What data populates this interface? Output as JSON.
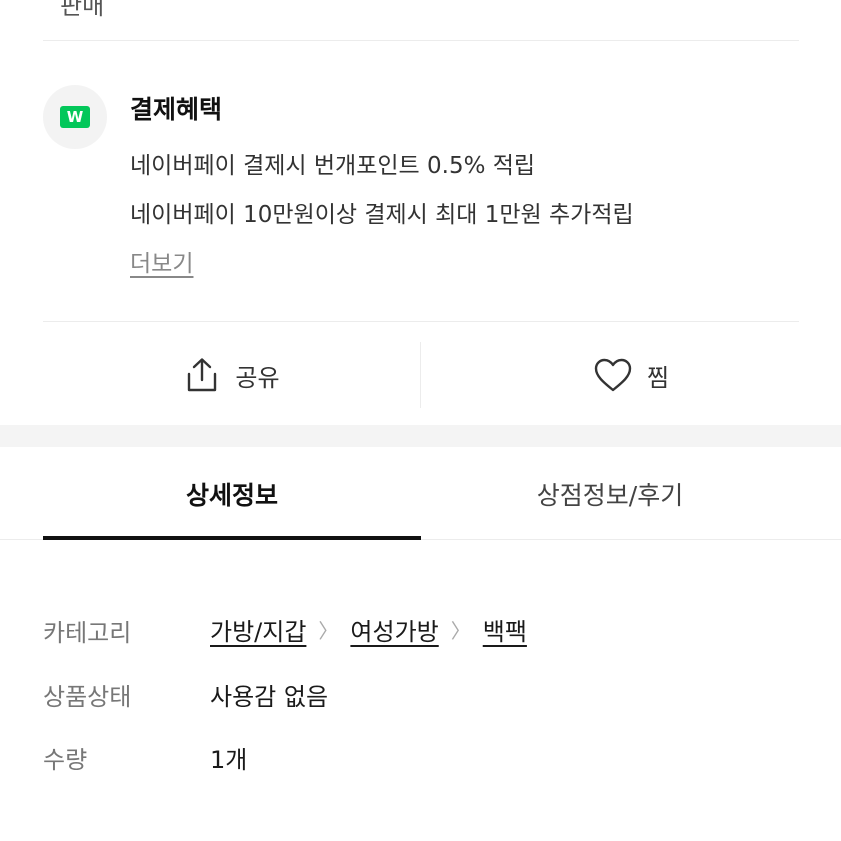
{
  "top_cut": {
    "text": "판매",
    "icons": [
      "share-icon",
      "heart-icon",
      "more-icon"
    ]
  },
  "benefit": {
    "logo_text": "W",
    "title": "결제혜택",
    "lines": [
      "네이버페이 결제시 번개포인트 0.5% 적립",
      "네이버페이 10만원이상 결제시 최대 1만원 추가적립"
    ],
    "more_label": "더보기"
  },
  "actions": {
    "share_label": "공유",
    "like_label": "찜"
  },
  "tabs": [
    {
      "label": "상세정보",
      "active": true
    },
    {
      "label": "상점정보/후기",
      "active": false
    }
  ],
  "details": {
    "category_label": "카테고리",
    "categories": [
      "가방/지갑",
      "여성가방",
      "백팩"
    ],
    "condition_label": "상품상태",
    "condition_value": "사용감 없음",
    "quantity_label": "수량",
    "quantity_value": "1개"
  },
  "colors": {
    "naverpay_green": "#03c75a",
    "text": "#1a1a1a",
    "muted": "#777777"
  }
}
